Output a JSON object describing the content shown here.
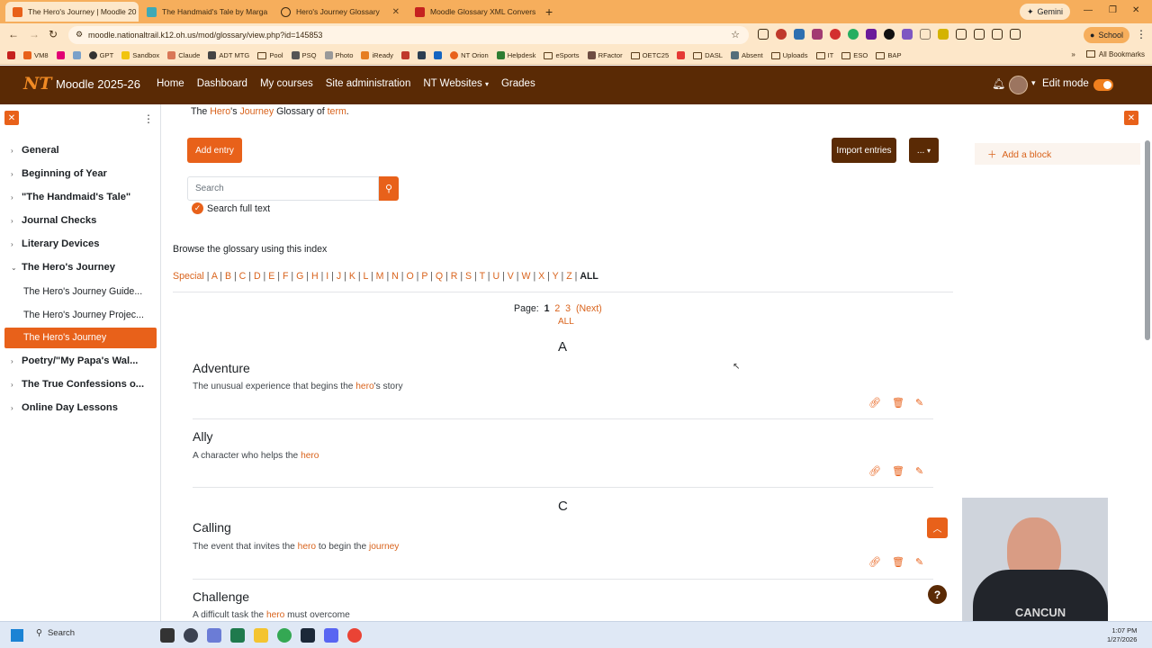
{
  "browser": {
    "tabs": [
      {
        "label": "The Hero's Journey | Moodle 20",
        "active": true
      },
      {
        "label": "The Handmaid's Tale by Marga",
        "active": false
      },
      {
        "label": "Hero's Journey Glossary",
        "active": false
      },
      {
        "label": "Moodle Glossary XML Convers",
        "active": false
      }
    ],
    "gemini_label": "Gemini",
    "url": "moodle.nationaltrail.k12.oh.us/mod/glossary/view.php?id=145853",
    "profile_label": "School",
    "bookmarks": [
      "VM8",
      "GPT",
      "Sandbox",
      "Claude",
      "ADT MTG",
      "Pool",
      "PSQ",
      "Photo",
      "iReady",
      "NT Orion",
      "Helpdesk",
      "eSports",
      "RFactor",
      "OETC25",
      "DASL",
      "Absent",
      "Uploads",
      "IT",
      "ESO",
      "BAP"
    ],
    "all_bookmarks": "All Bookmarks"
  },
  "navbar": {
    "site_name": "Moodle 2025-26",
    "links": [
      "Home",
      "Dashboard",
      "My courses",
      "Site administration",
      "NT Websites",
      "Grades"
    ],
    "edit_mode": "Edit mode"
  },
  "drawer": {
    "sections": [
      {
        "label": "General",
        "expanded": false
      },
      {
        "label": "Beginning of Year",
        "expanded": false
      },
      {
        "label": "\"The Handmaid's Tale\"",
        "expanded": false
      },
      {
        "label": "Journal Checks",
        "expanded": false
      },
      {
        "label": "Literary Devices",
        "expanded": false
      },
      {
        "label": "The Hero's Journey",
        "expanded": true
      }
    ],
    "subitems": [
      "The Hero's Journey Guide...",
      "The Hero's Journey Projec...",
      "The Hero's Journey"
    ],
    "sections_after": [
      "Poetry/\"My Papa's Wal...",
      "The True Confessions o...",
      "Online Day Lessons"
    ]
  },
  "main": {
    "intro": {
      "prefix": "The ",
      "w1": "Hero",
      "mid1": "'s ",
      "w2": "Journey",
      "mid2": " Glossary of ",
      "w3": "term",
      "end": "."
    },
    "add_entry": "Add entry",
    "import_entries": "Import entries",
    "more_label": "...",
    "search_placeholder": "Search",
    "search_full_text": "Search full text",
    "browse_label": "Browse the glossary using this index",
    "letters": [
      "Special",
      "A",
      "B",
      "C",
      "D",
      "E",
      "F",
      "G",
      "H",
      "I",
      "J",
      "K",
      "L",
      "M",
      "N",
      "O",
      "P",
      "Q",
      "R",
      "S",
      "T",
      "U",
      "V",
      "W",
      "X",
      "Y",
      "Z"
    ],
    "all_letters": "ALL",
    "page_label": "Page:",
    "pages": [
      "1",
      "2",
      "3"
    ],
    "next_label": "(Next)",
    "all_pages": "ALL",
    "groups": [
      {
        "letter": "A",
        "entries": [
          {
            "term": "Adventure",
            "def_before": "The unusual experience that begins the ",
            "link": "hero",
            "def_after": "'s story"
          },
          {
            "term": "Ally",
            "def_before": "A character who helps the ",
            "link": "hero",
            "def_after": ""
          }
        ]
      },
      {
        "letter": "C",
        "entries": [
          {
            "term": "Calling",
            "def_before": "The event that invites the ",
            "link": "hero",
            "def_mid": " to begin the ",
            "link2": "journey",
            "def_after": ""
          },
          {
            "term": "Challenge",
            "def_before": "A difficult task the ",
            "link": "hero",
            "def_after": " must overcome"
          }
        ]
      }
    ]
  },
  "right": {
    "add_block": "Add a block",
    "help": "?"
  },
  "webcam": {
    "shirt_text": "CANCUN"
  },
  "taskbar": {
    "search": "Search",
    "time": "1:07 PM",
    "date": "1/27/2026"
  }
}
